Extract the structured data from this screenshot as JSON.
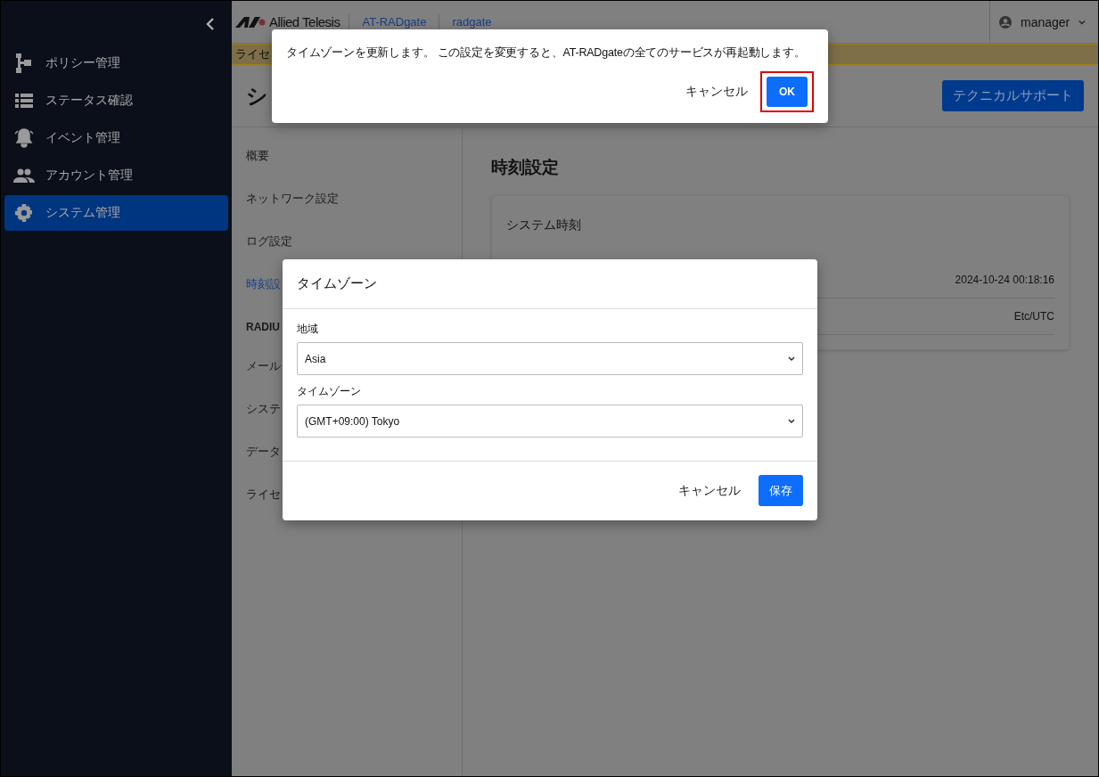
{
  "sidebar": {
    "items": [
      {
        "label": "ポリシー管理",
        "kind": "policy",
        "selected": false
      },
      {
        "label": "ステータス確認",
        "kind": "list",
        "selected": false
      },
      {
        "label": "イベント管理",
        "kind": "bell",
        "selected": false
      },
      {
        "label": "アカウント管理",
        "kind": "people",
        "selected": false
      },
      {
        "label": "システム管理",
        "kind": "gear",
        "selected": true
      }
    ]
  },
  "header": {
    "logo_text": "Allied Telesis",
    "product": "AT-RADgate",
    "host": "radgate",
    "user": "manager"
  },
  "banner": {
    "text": "ライセ"
  },
  "page": {
    "title": "シ",
    "support_button": "テクニカルサポート"
  },
  "settings_nav": {
    "items": [
      {
        "label": "概要",
        "kind": "link",
        "selected": false
      },
      {
        "label": "ネットワーク設定",
        "kind": "link",
        "selected": false
      },
      {
        "label": "ログ設定",
        "kind": "link",
        "selected": false
      },
      {
        "label": "時刻設",
        "kind": "link",
        "selected": true
      },
      {
        "label": "RADIU",
        "kind": "header",
        "selected": false
      },
      {
        "label": "メール",
        "kind": "link",
        "selected": false
      },
      {
        "label": "システ",
        "kind": "link",
        "selected": false
      },
      {
        "label": "データ",
        "kind": "link",
        "selected": false
      },
      {
        "label": "ライセ",
        "kind": "link",
        "selected": false
      }
    ]
  },
  "content": {
    "title": "時刻設定",
    "card": {
      "title": "システム時刻",
      "rows": [
        {
          "value": "2024-10-24 00:18:16"
        },
        {
          "value": "Etc/UTC"
        }
      ]
    }
  },
  "timezone_dialog": {
    "title": "タイムゾーン",
    "fields": [
      {
        "label": "地域",
        "value": "Asia"
      },
      {
        "label": "タイムゾーン",
        "value": "(GMT+09:00) Tokyo"
      }
    ],
    "cancel": "キャンセル",
    "save": "保存"
  },
  "confirm_dialog": {
    "message": "タイムゾーンを更新します。 この設定を変更すると、AT-RADgateの全てのサービスが再起動します。",
    "cancel": "キャンセル",
    "ok": "OK",
    "ok_highlighted": true
  }
}
